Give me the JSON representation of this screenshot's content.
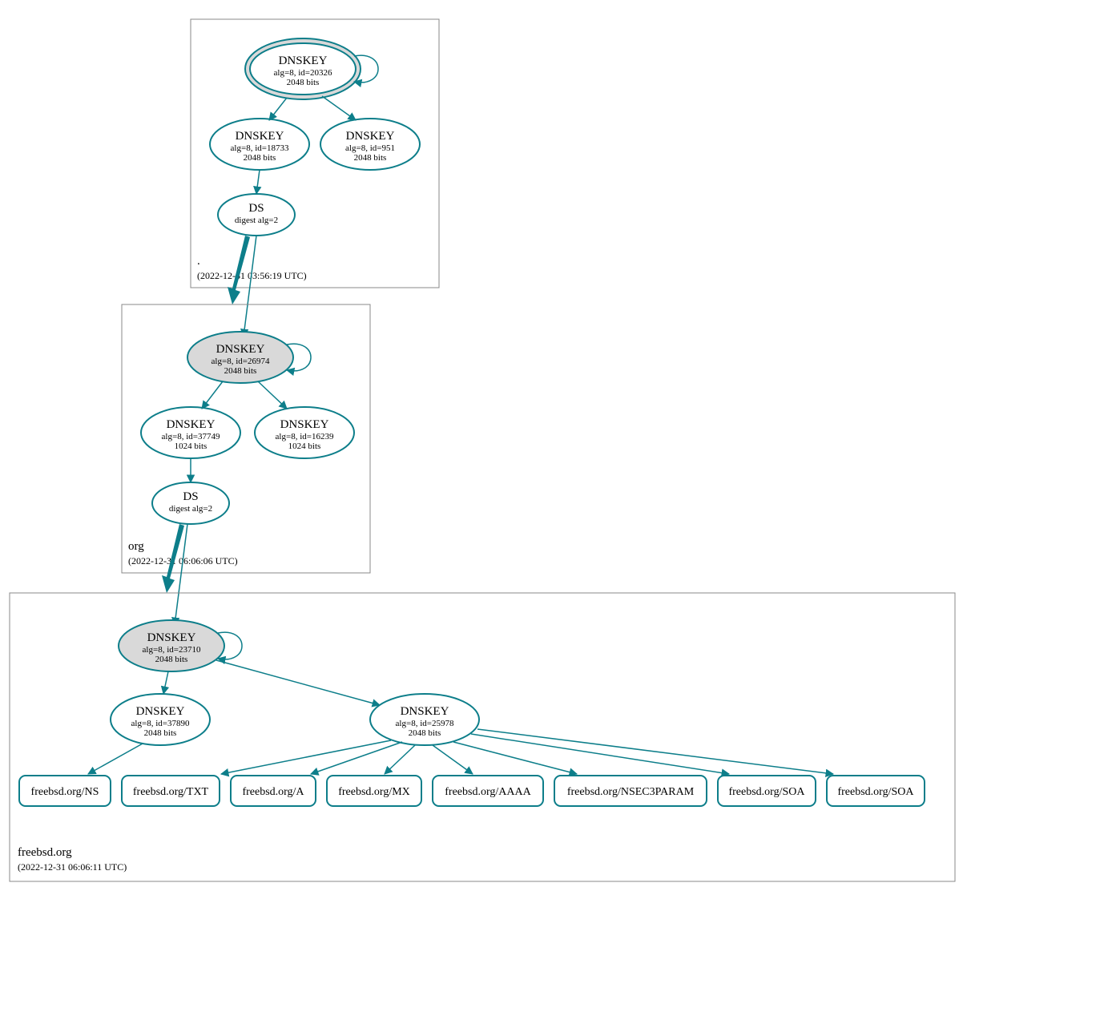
{
  "colors": {
    "accent": "#0d7e8a",
    "fillGray": "#d9d9d9"
  },
  "zones": {
    "root": {
      "label": ".",
      "timestamp": "(2022-12-31 03:56:19 UTC)"
    },
    "org": {
      "label": "org",
      "timestamp": "(2022-12-31 06:06:06 UTC)"
    },
    "freebsd": {
      "label": "freebsd.org",
      "timestamp": "(2022-12-31 06:06:11 UTC)"
    }
  },
  "nodes": {
    "root_ksk": {
      "title": "DNSKEY",
      "line2": "alg=8, id=20326",
      "line3": "2048 bits"
    },
    "root_zsk1": {
      "title": "DNSKEY",
      "line2": "alg=8, id=18733",
      "line3": "2048 bits"
    },
    "root_zsk2": {
      "title": "DNSKEY",
      "line2": "alg=8, id=951",
      "line3": "2048 bits"
    },
    "root_ds": {
      "title": "DS",
      "line2": "digest alg=2"
    },
    "org_ksk": {
      "title": "DNSKEY",
      "line2": "alg=8, id=26974",
      "line3": "2048 bits"
    },
    "org_zsk1": {
      "title": "DNSKEY",
      "line2": "alg=8, id=37749",
      "line3": "1024 bits"
    },
    "org_zsk2": {
      "title": "DNSKEY",
      "line2": "alg=8, id=16239",
      "line3": "1024 bits"
    },
    "org_ds": {
      "title": "DS",
      "line2": "digest alg=2"
    },
    "fbsd_ksk": {
      "title": "DNSKEY",
      "line2": "alg=8, id=23710",
      "line3": "2048 bits"
    },
    "fbsd_zsk1": {
      "title": "DNSKEY",
      "line2": "alg=8, id=37890",
      "line3": "2048 bits"
    },
    "fbsd_zsk2": {
      "title": "DNSKEY",
      "line2": "alg=8, id=25978",
      "line3": "2048 bits"
    }
  },
  "rrsets": {
    "ns": "freebsd.org/NS",
    "txt": "freebsd.org/TXT",
    "a": "freebsd.org/A",
    "mx": "freebsd.org/MX",
    "aaaa": "freebsd.org/AAAA",
    "nsec3": "freebsd.org/NSEC3PARAM",
    "soa1": "freebsd.org/SOA",
    "soa2": "freebsd.org/SOA"
  }
}
